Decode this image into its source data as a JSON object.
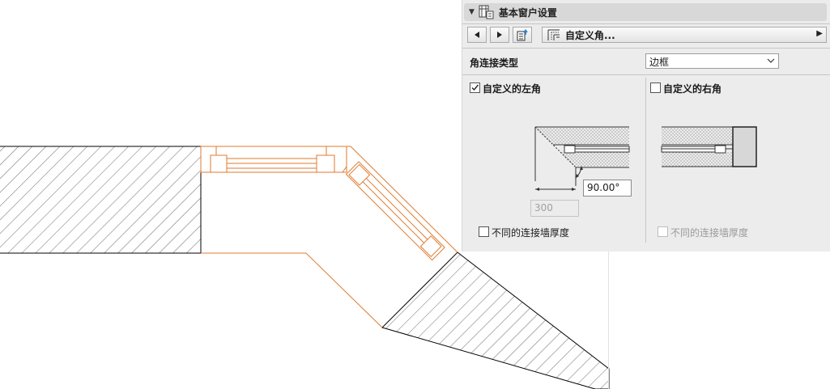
{
  "panel": {
    "title": "基本窗户设置",
    "toolbar": {
      "dropdown_label": "自定义角..."
    },
    "corner_connection": {
      "label": "角连接类型",
      "value": "边框"
    },
    "left_corner": {
      "label": "自定义的左角",
      "checked": true,
      "angle_value": "90.00°",
      "dimension_value": "300",
      "different_thickness_label": "不同的连接墙厚度",
      "different_thickness_checked": false
    },
    "right_corner": {
      "label": "自定义的右角",
      "checked": false,
      "different_thickness_label": "不同的连接墙厚度",
      "different_thickness_checked": false,
      "different_thickness_enabled": false
    }
  },
  "colors": {
    "window_outline": "#e07a2e",
    "wall_outline": "#000000",
    "panel_bg": "#ececec"
  },
  "icons": {
    "collapse": "triangle-down-icon",
    "window_settings": "window-settings-icon",
    "prev": "arrow-left-icon",
    "next": "arrow-right-icon",
    "favorites": "favorites-icon",
    "custom_corner": "custom-corner-icon",
    "submenu": "arrow-right-small-icon",
    "dropdown": "chevron-down-icon",
    "check": "check-icon"
  }
}
